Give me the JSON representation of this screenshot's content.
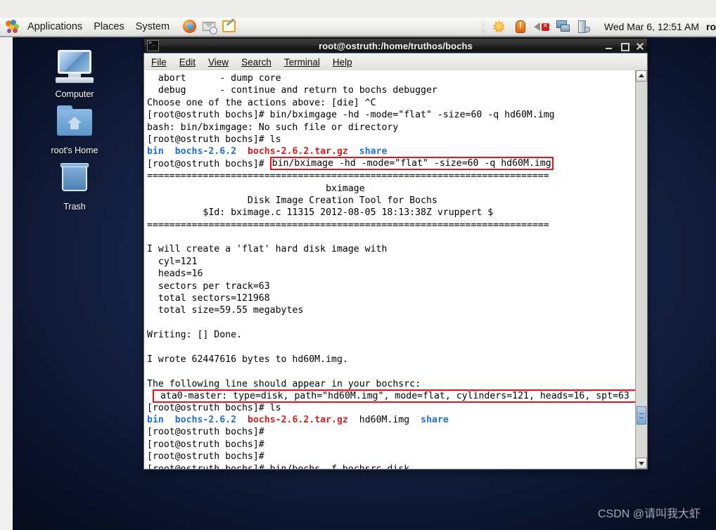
{
  "panel": {
    "menus": [
      "Applications",
      "Places",
      "System"
    ],
    "launchers": [
      {
        "name": "firefox-icon",
        "label": "Firefox Web Browser"
      },
      {
        "name": "mail-icon",
        "label": "Evolution Mail"
      },
      {
        "name": "text-editor-icon",
        "label": "Text Editor"
      }
    ],
    "tray": [
      {
        "name": "update-notifier-icon"
      },
      {
        "name": "alert-icon"
      },
      {
        "name": "volume-muted-icon"
      },
      {
        "name": "network-icon"
      },
      {
        "name": "battery-icon"
      }
    ],
    "clock": "Wed Mar  6, 12:51 AM",
    "user": "ro"
  },
  "desktop": {
    "icons": [
      {
        "name": "computer-icon",
        "label": "Computer"
      },
      {
        "name": "home-folder-icon",
        "label": "root's Home"
      },
      {
        "name": "trash-icon",
        "label": "Trash"
      }
    ],
    "watermark": "CSDN @请叫我大虾"
  },
  "terminal": {
    "title": "root@ostruth:/home/truthos/bochs",
    "menus": [
      {
        "label": "File",
        "accel": "F"
      },
      {
        "label": "Edit",
        "accel": "E"
      },
      {
        "label": "View",
        "accel": "V"
      },
      {
        "label": "Search",
        "accel": "S"
      },
      {
        "label": "Terminal",
        "accel": "T"
      },
      {
        "label": "Help",
        "accel": "H"
      }
    ],
    "window_buttons": [
      "minimize",
      "maximize",
      "close"
    ],
    "prompt": "[root@ostruth bochs]# ",
    "lines": [
      {
        "type": "plain",
        "text": "  abort      - dump core"
      },
      {
        "type": "plain",
        "text": "  debug      - continue and return to bochs debugger"
      },
      {
        "type": "plain",
        "text": "Choose one of the actions above: [die] ^C"
      },
      {
        "type": "prompt",
        "text": "bin/bximgage -hd -mode=\"flat\" -size=60 -q hd60M.img"
      },
      {
        "type": "plain",
        "text": "bash: bin/bximgage: No such file or directory"
      },
      {
        "type": "prompt",
        "text": "ls"
      },
      {
        "type": "ls",
        "parts": [
          {
            "text": "bin",
            "color": "blue"
          },
          {
            "text": "  ",
            "color": "plain"
          },
          {
            "text": "bochs-2.6.2",
            "color": "blue"
          },
          {
            "text": "  ",
            "color": "plain"
          },
          {
            "text": "bochs-2.6.2.tar.gz",
            "color": "red"
          },
          {
            "text": "  ",
            "color": "plain"
          },
          {
            "text": "share",
            "color": "blue"
          }
        ]
      },
      {
        "type": "prompt-highlight",
        "text": "bin/bximage -hd -mode=\"flat\" -size=60 -q hd60M.img"
      },
      {
        "type": "plain",
        "text": "========================================================================"
      },
      {
        "type": "plain",
        "text": "                                bximage"
      },
      {
        "type": "plain",
        "text": "                  Disk Image Creation Tool for Bochs"
      },
      {
        "type": "plain",
        "text": "          $Id: bximage.c 11315 2012-08-05 18:13:38Z vruppert $"
      },
      {
        "type": "plain",
        "text": "========================================================================"
      },
      {
        "type": "plain",
        "text": ""
      },
      {
        "type": "plain",
        "text": "I will create a 'flat' hard disk image with"
      },
      {
        "type": "plain",
        "text": "  cyl=121"
      },
      {
        "type": "plain",
        "text": "  heads=16"
      },
      {
        "type": "plain",
        "text": "  sectors per track=63"
      },
      {
        "type": "plain",
        "text": "  total sectors=121968"
      },
      {
        "type": "plain",
        "text": "  total size=59.55 megabytes"
      },
      {
        "type": "plain",
        "text": ""
      },
      {
        "type": "plain",
        "text": "Writing: [] Done."
      },
      {
        "type": "plain",
        "text": ""
      },
      {
        "type": "plain",
        "text": "I wrote 62447616 bytes to hd60M.img."
      },
      {
        "type": "plain",
        "text": ""
      },
      {
        "type": "plain",
        "text": "The following line should appear in your bochsrc:"
      },
      {
        "type": "highlight-wide",
        "text": "ata0-master: type=disk, path=\"hd60M.img\", mode=flat, cylinders=121, heads=16, spt=63"
      },
      {
        "type": "prompt",
        "text": "ls"
      },
      {
        "type": "ls",
        "parts": [
          {
            "text": "bin",
            "color": "blue"
          },
          {
            "text": "  ",
            "color": "plain"
          },
          {
            "text": "bochs-2.6.2",
            "color": "blue"
          },
          {
            "text": "  ",
            "color": "plain"
          },
          {
            "text": "bochs-2.6.2.tar.gz",
            "color": "red"
          },
          {
            "text": "  ",
            "color": "plain"
          },
          {
            "text": "hd60M.img",
            "color": "plain"
          },
          {
            "text": "  ",
            "color": "plain"
          },
          {
            "text": "share",
            "color": "blue"
          }
        ]
      },
      {
        "type": "prompt",
        "text": ""
      },
      {
        "type": "prompt",
        "text": ""
      },
      {
        "type": "prompt",
        "text": ""
      },
      {
        "type": "prompt",
        "text": "bin/bochs -f bochsrc.disk"
      }
    ]
  },
  "colors": {
    "dir_blue": "#1f6fd4",
    "archive_red": "#d41f1f",
    "highlight_red": "#ee1111",
    "terminal_bg": "#ffffff",
    "terminal_fg": "#000000",
    "desktop_blue": "#16234a"
  }
}
